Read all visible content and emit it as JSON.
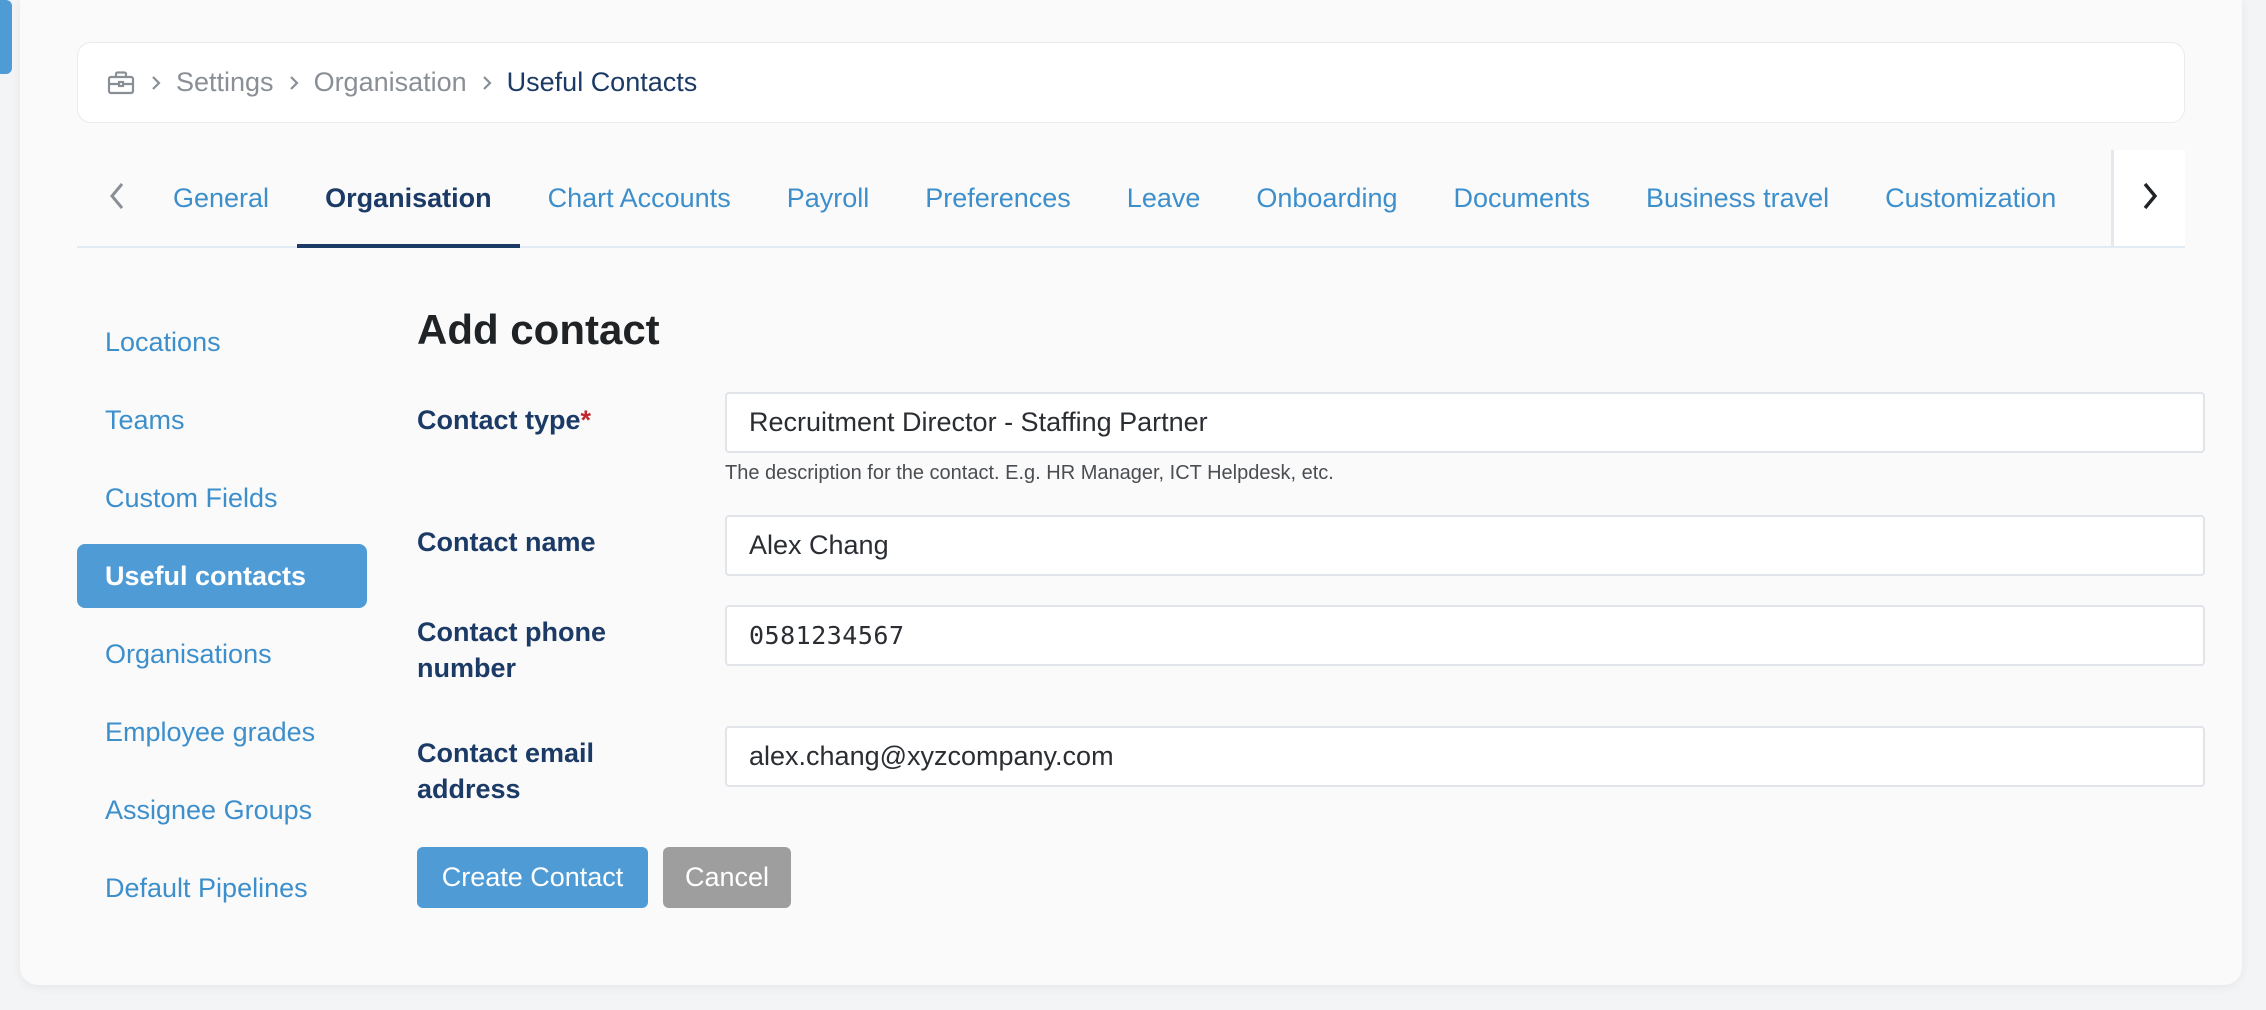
{
  "breadcrumb": {
    "icon": "briefcase-icon",
    "items": [
      "Settings",
      "Organisation"
    ],
    "current": "Useful Contacts"
  },
  "tabs": [
    {
      "label": "General"
    },
    {
      "label": "Organisation",
      "active": true
    },
    {
      "label": "Chart Accounts"
    },
    {
      "label": "Payroll"
    },
    {
      "label": "Preferences"
    },
    {
      "label": "Leave"
    },
    {
      "label": "Onboarding"
    },
    {
      "label": "Documents"
    },
    {
      "label": "Business travel"
    },
    {
      "label": "Customization"
    }
  ],
  "sidenav": [
    {
      "label": "Locations"
    },
    {
      "label": "Teams"
    },
    {
      "label": "Custom Fields"
    },
    {
      "label": "Useful contacts",
      "active": true
    },
    {
      "label": "Organisations"
    },
    {
      "label": "Employee grades"
    },
    {
      "label": "Assignee Groups"
    },
    {
      "label": "Default Pipelines"
    }
  ],
  "form": {
    "title": "Add contact",
    "contact_type": {
      "label": "Contact type",
      "required_mark": "*",
      "value": "Recruitment Director - Staffing Partner",
      "hint": "The description for the contact. E.g. HR Manager, ICT Helpdesk, etc."
    },
    "contact_name": {
      "label": "Contact name",
      "value": "Alex Chang"
    },
    "contact_phone": {
      "label_line1": "Contact phone",
      "label_line2": "number",
      "value": "0581234567"
    },
    "contact_email": {
      "label_line1": "Contact email",
      "label_line2": "address",
      "value": "alex.chang@xyzcompany.com"
    },
    "create_button": "Create Contact",
    "cancel_button": "Cancel"
  },
  "colors": {
    "accent": "#4e9bd6",
    "link": "#3d8fcc",
    "heading": "#1b3a66",
    "required": "#c0262d",
    "secondary_button": "#9e9e9e"
  }
}
